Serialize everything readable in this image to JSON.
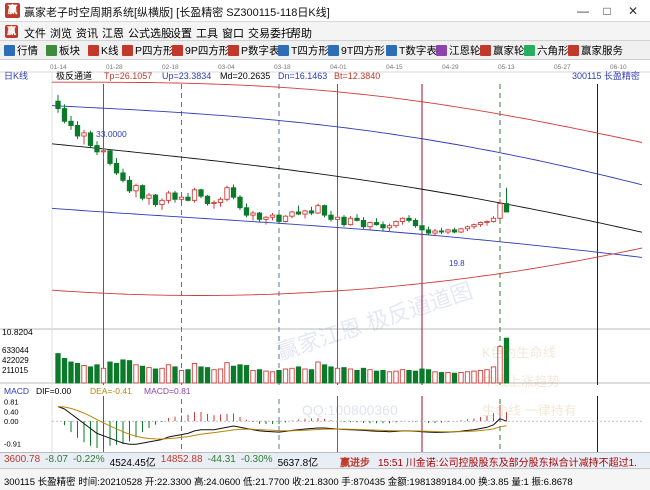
{
  "window": {
    "title": "赢家老子时空周期系统[纵横版]  [长盈精密  SZ300115-118日K线]",
    "minimize": "—",
    "maximize": "□",
    "close": "✕"
  },
  "menu": {
    "logo": "赢",
    "items": [
      "文件",
      "浏览",
      "资讯",
      "江恩",
      "公式选股",
      "设置",
      "工具",
      "窗口",
      "交易委托",
      "帮助"
    ]
  },
  "toolbar": {
    "items": [
      {
        "label": "行情",
        "icon": "grid-icon",
        "color": "#2d6db5"
      },
      {
        "label": "板块",
        "icon": "blocks-icon",
        "color": "#3c8c3c"
      },
      {
        "label": "K线",
        "icon": "candle-icon",
        "color": "#c0392b"
      },
      {
        "label": "P四方形",
        "icon": "p-square-icon",
        "color": "#c0392b"
      },
      {
        "label": "9P四方形",
        "icon": "9p-square-icon",
        "color": "#c0392b"
      },
      {
        "label": "P数字表",
        "icon": "p-table-icon",
        "color": "#c0392b"
      },
      {
        "label": "T四方形",
        "icon": "t-square-icon",
        "color": "#2d6db5"
      },
      {
        "label": "9T四方形",
        "icon": "9t-square-icon",
        "color": "#2d6db5"
      },
      {
        "label": "T数字表",
        "icon": "t-table-icon",
        "color": "#2d6db5"
      },
      {
        "label": "江恩轮",
        "icon": "gann-wheel-icon",
        "color": "#8e44ad"
      },
      {
        "label": "赢家轮",
        "icon": "winner-wheel-icon",
        "color": "#c0392b"
      },
      {
        "label": "六角形",
        "icon": "hexagon-icon",
        "color": "#27ae60"
      },
      {
        "label": "赢家服务",
        "icon": "service-icon",
        "color": "#c0392b"
      }
    ]
  },
  "chart_header": {
    "period_tag": "日K线",
    "indicator_name": "极反通道",
    "params": [
      {
        "label": "Tp=26.1057",
        "color": "#c0392b"
      },
      {
        "label": "Up=23.3834",
        "color": "#2d3db5"
      },
      {
        "label": "Md=20.2635",
        "color": "#000000"
      },
      {
        "label": "Dn=16.1463",
        "color": "#2d3db5"
      },
      {
        "label": "Bt=12.3840",
        "color": "#c0392b"
      }
    ],
    "stock_label": "300115  长盈精密"
  },
  "date_ticks": [
    "01-14",
    "01-28",
    "02-18",
    "03-04",
    "03-18",
    "04-01",
    "04-15",
    "04-29",
    "05-13",
    "05-27",
    "06-10"
  ],
  "price_labels": {
    "high_marker": "33.0000",
    "low_marker": "19.8",
    "low_left": "10.8204"
  },
  "volume_labels": [
    "633044",
    "422029",
    "211015"
  ],
  "macd_header": {
    "name": "MACD",
    "dif": "DIF=0.00",
    "dea": "DEA=-0.41",
    "macd": "MACD=0.81"
  },
  "macd_axis": [
    "0.81",
    "0.40",
    "0.00",
    "-0.91"
  ],
  "watermarks": [
    "赢家江恩  极反通道图",
    "QQ:100800360",
    "K色为生命线",
    "中线上涨趋势",
    "生命线  一律持有"
  ],
  "chart_data": {
    "type": "candlestick",
    "dates": [
      "01-14",
      "01-28",
      "02-18",
      "03-04",
      "03-18",
      "04-01",
      "04-15",
      "04-29",
      "05-13",
      "05-27",
      "06-10"
    ],
    "ohlc": [
      [
        32.3,
        32.9,
        31.2,
        31.6
      ],
      [
        31.6,
        32.0,
        30.2,
        30.4
      ],
      [
        30.4,
        30.9,
        29.6,
        30.0
      ],
      [
        30.0,
        30.4,
        28.7,
        29.0
      ],
      [
        29.0,
        29.6,
        28.2,
        29.3
      ],
      [
        29.3,
        29.5,
        27.9,
        28.1
      ],
      [
        28.1,
        28.5,
        27.2,
        27.5
      ],
      [
        27.5,
        28.0,
        26.8,
        27.6
      ],
      [
        27.6,
        27.7,
        26.2,
        26.4
      ],
      [
        26.4,
        26.9,
        25.3,
        25.5
      ],
      [
        25.5,
        25.9,
        24.6,
        24.8
      ],
      [
        24.8,
        25.2,
        23.6,
        23.8
      ],
      [
        23.8,
        24.5,
        23.2,
        24.3
      ],
      [
        24.3,
        24.4,
        22.9,
        23.1
      ],
      [
        23.1,
        23.6,
        22.5,
        23.4
      ],
      [
        23.4,
        23.5,
        22.3,
        22.5
      ],
      [
        22.5,
        23.1,
        22.0,
        22.9
      ],
      [
        22.9,
        23.8,
        22.6,
        23.6
      ],
      [
        23.6,
        23.8,
        22.7,
        23.0
      ],
      [
        23.0,
        23.3,
        22.6,
        23.2
      ],
      [
        23.2,
        23.6,
        22.8,
        22.9
      ],
      [
        22.9,
        24.1,
        22.7,
        23.9
      ],
      [
        23.9,
        24.0,
        23.1,
        23.3
      ],
      [
        23.3,
        23.4,
        22.4,
        22.6
      ],
      [
        22.6,
        22.9,
        22.1,
        22.7
      ],
      [
        22.7,
        23.2,
        22.3,
        23.0
      ],
      [
        23.0,
        24.3,
        22.8,
        24.1
      ],
      [
        24.1,
        24.4,
        23.0,
        23.2
      ],
      [
        23.2,
        23.4,
        22.0,
        22.2
      ],
      [
        22.2,
        22.6,
        21.3,
        21.5
      ],
      [
        21.5,
        21.9,
        21.0,
        21.7
      ],
      [
        21.7,
        21.8,
        20.9,
        21.1
      ],
      [
        21.1,
        21.4,
        20.6,
        21.3
      ],
      [
        21.3,
        21.7,
        21.0,
        21.5
      ],
      [
        21.5,
        21.6,
        20.7,
        20.9
      ],
      [
        20.9,
        21.5,
        20.8,
        21.4
      ],
      [
        21.4,
        21.9,
        21.2,
        21.8
      ],
      [
        21.8,
        22.4,
        21.5,
        21.6
      ],
      [
        21.6,
        22.0,
        21.2,
        21.9
      ],
      [
        21.9,
        22.3,
        21.5,
        21.7
      ],
      [
        21.7,
        22.6,
        21.6,
        22.4
      ],
      [
        22.4,
        22.5,
        21.3,
        21.5
      ],
      [
        21.5,
        21.9,
        20.9,
        21.1
      ],
      [
        21.1,
        21.5,
        20.6,
        21.3
      ],
      [
        21.3,
        21.5,
        20.4,
        20.6
      ],
      [
        20.6,
        21.4,
        20.5,
        21.2
      ],
      [
        21.2,
        21.6,
        20.9,
        21.0
      ],
      [
        21.0,
        21.3,
        20.2,
        20.4
      ],
      [
        20.4,
        20.9,
        20.1,
        20.8
      ],
      [
        20.8,
        21.2,
        20.5,
        20.6
      ],
      [
        20.6,
        20.9,
        20.0,
        20.3
      ],
      [
        20.3,
        20.7,
        19.9,
        20.5
      ],
      [
        20.5,
        21.0,
        20.3,
        20.9
      ],
      [
        20.9,
        21.3,
        20.6,
        21.2
      ],
      [
        21.2,
        21.5,
        20.8,
        21.0
      ],
      [
        21.0,
        21.2,
        20.3,
        20.5
      ],
      [
        20.5,
        20.8,
        19.9,
        20.1
      ],
      [
        20.1,
        20.4,
        19.6,
        19.8
      ],
      [
        19.8,
        20.2,
        19.5,
        20.0
      ],
      [
        20.0,
        20.3,
        19.7,
        19.9
      ],
      [
        19.9,
        20.2,
        19.7,
        20.1
      ],
      [
        20.1,
        20.3,
        19.8,
        19.9
      ],
      [
        19.9,
        20.3,
        19.8,
        20.2
      ],
      [
        20.2,
        20.5,
        20.0,
        20.4
      ],
      [
        20.4,
        20.7,
        20.2,
        20.6
      ],
      [
        20.6,
        20.9,
        20.4,
        20.8
      ],
      [
        20.8,
        21.0,
        20.5,
        20.9
      ],
      [
        20.9,
        21.4,
        20.8,
        21.2
      ],
      [
        21.2,
        23.0,
        21.1,
        22.6
      ],
      [
        22.6,
        24.1,
        22.4,
        21.8
      ]
    ],
    "volume": [
      420000,
      350000,
      300000,
      280000,
      250000,
      230000,
      260000,
      210000,
      300000,
      280000,
      330000,
      320000,
      260000,
      240000,
      220000,
      200000,
      210000,
      260000,
      230000,
      180000,
      190000,
      280000,
      230000,
      220000,
      190000,
      200000,
      290000,
      240000,
      260000,
      250000,
      180000,
      190000,
      170000,
      160000,
      180000,
      200000,
      210000,
      230000,
      200000,
      190000,
      300000,
      260000,
      230000,
      210000,
      220000,
      200000,
      180000,
      210000,
      190000,
      170000,
      180000,
      160000,
      170000,
      190000,
      180000,
      170000,
      200000,
      190000,
      160000,
      150000,
      150000,
      140000,
      150000,
      160000,
      170000,
      180000,
      190000,
      230000,
      520000,
      640000
    ],
    "macd_dif": [
      0.6,
      0.5,
      0.3,
      0.1,
      -0.1,
      -0.3,
      -0.5,
      -0.6,
      -0.7,
      -0.8,
      -0.9,
      -0.95,
      -0.95,
      -0.9,
      -0.85,
      -0.8,
      -0.75,
      -0.65,
      -0.6,
      -0.55,
      -0.5,
      -0.4,
      -0.35,
      -0.35,
      -0.35,
      -0.3,
      -0.25,
      -0.2,
      -0.25,
      -0.3,
      -0.35,
      -0.4,
      -0.42,
      -0.43,
      -0.45,
      -0.42,
      -0.38,
      -0.35,
      -0.32,
      -0.3,
      -0.28,
      -0.28,
      -0.3,
      -0.32,
      -0.34,
      -0.35,
      -0.36,
      -0.38,
      -0.4,
      -0.41,
      -0.42,
      -0.43,
      -0.42,
      -0.4,
      -0.4,
      -0.41,
      -0.43,
      -0.45,
      -0.46,
      -0.46,
      -0.45,
      -0.43,
      -0.41,
      -0.38,
      -0.35,
      -0.3,
      -0.25,
      -0.15,
      0.1,
      0.0
    ],
    "channel": {
      "tp": 26.1057,
      "up": 23.3834,
      "md": 20.2635,
      "dn": 16.1463,
      "bt": 12.384
    },
    "ylim": [
      10.8,
      34.5
    ],
    "vol_ylim": [
      0,
      700000
    ],
    "macd_ylim": [
      -1.1,
      0.95
    ],
    "vertical_markers": [
      {
        "index": 7,
        "style": "solid",
        "color": "#2e7d32"
      },
      {
        "index": 19,
        "style": "dashed",
        "color": "#6070a0"
      },
      {
        "index": 34,
        "style": "dashed",
        "color": "#6070a0"
      },
      {
        "index": 43,
        "style": "solid",
        "color": "#8e44ad"
      },
      {
        "index": 56,
        "style": "solid",
        "color": "#a01030"
      },
      {
        "index": 68,
        "style": "dashed",
        "color": "#2e7d32"
      },
      {
        "index": 83,
        "style": "solid",
        "color": "#222222"
      }
    ]
  },
  "status": {
    "indices": [
      {
        "label": "3600.78",
        "color": "#c0392b"
      },
      {
        "label": "-8.07",
        "color": "#2e7d32"
      },
      {
        "label": "-0.22%",
        "color": "#2e7d32"
      },
      {
        "label": "4524.45亿",
        "color": "#000"
      },
      {
        "label": "14852.88",
        "color": "#c0392b"
      },
      {
        "label": "-44.31",
        "color": "#2e7d32"
      },
      {
        "label": "-0.30%",
        "color": "#2e7d32"
      },
      {
        "label": "5637.8亿",
        "color": "#000"
      }
    ],
    "brand": "赢进步",
    "news": "15:51 川金诺:公司控股股东及部分股东拟合计减持不超过1.",
    "quote": "300115 长盈精密 时间:20210528 开:22.3300 高:24.0600 低:21.7700 收:21.8300 手:870435 金额:1981389184.00 换:3.85 量:1 振:6.8678"
  }
}
